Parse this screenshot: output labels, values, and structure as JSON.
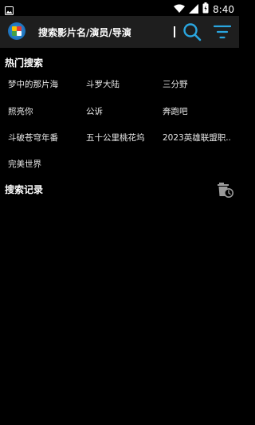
{
  "status_bar": {
    "time": "8:40",
    "icons": [
      "image-icon",
      "wifi-icon",
      "signal-icon",
      "battery-icon"
    ]
  },
  "header": {
    "logo": "app-logo",
    "search_placeholder": "搜索影片名/演员/导演",
    "search_icon": "search-icon",
    "filter_icon": "filter-icon",
    "accent_color": "#2aa6e0"
  },
  "hot_search": {
    "title": "热门搜索",
    "items": [
      "梦中的那片海",
      "斗罗大陆",
      "三分野",
      "照亮你",
      "公诉",
      "奔跑吧",
      "斗破苍穹年番",
      "五十公里桃花坞",
      "2023英雄联盟职..",
      "完美世界"
    ]
  },
  "history": {
    "title": "搜索记录",
    "clear_icon": "trash-clock-icon"
  }
}
